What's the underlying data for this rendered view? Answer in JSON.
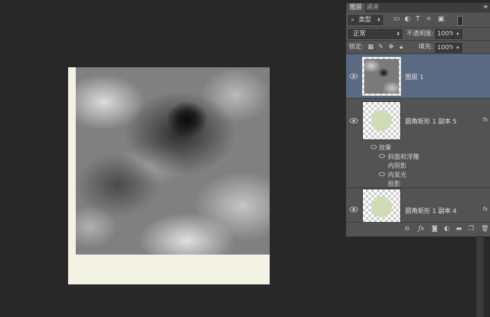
{
  "panel": {
    "tabs": {
      "layers": "图层",
      "channels": "通道"
    },
    "filter": {
      "icon": "search-icon",
      "value": "类型"
    },
    "blend_mode": "正常",
    "opacity": {
      "label": "不透明度:",
      "value": "100%"
    },
    "lock": {
      "label": "锁定:"
    },
    "fill": {
      "label": "填充:",
      "value": "100%"
    },
    "layers": [
      {
        "name": "图层 1",
        "selected": true,
        "thumb": "clouds"
      },
      {
        "name": "圆角矩形 1 副本 5",
        "fx": "fx",
        "effects_label": "效果",
        "effects": [
          "斜面和浮雕",
          "内阴影",
          "内发光",
          "投影"
        ]
      },
      {
        "name": "圆角矩形 1 副本 4",
        "fx": "fx"
      }
    ],
    "colors": {
      "selected_row": "#5a6a82",
      "panel_bg": "#535353",
      "canvas_bg": "#f2f3e4"
    }
  }
}
